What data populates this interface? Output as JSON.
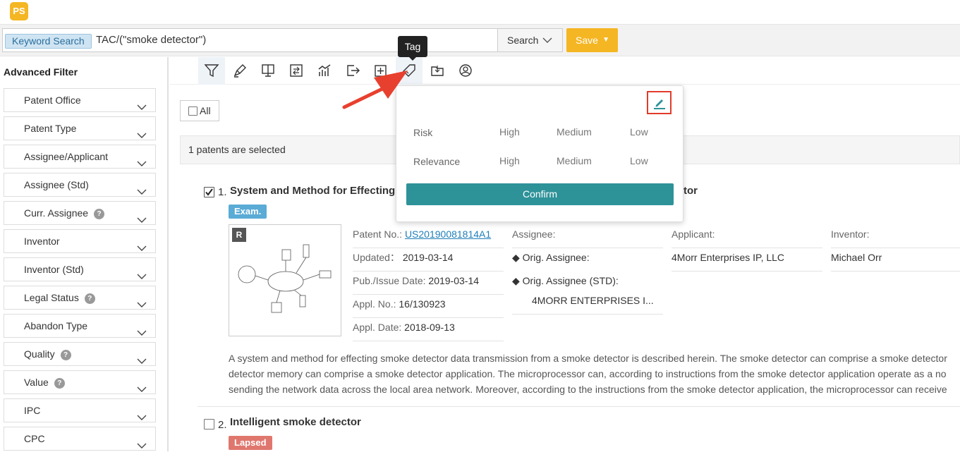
{
  "app": {
    "logo_text": "PS"
  },
  "search": {
    "tag": "Keyword Search",
    "query": "TAC/(\"smoke detector\")",
    "search_label": "Search",
    "save_label": "Save"
  },
  "sidebar": {
    "title": "Advanced Filter",
    "filters": [
      {
        "label": "Patent Office",
        "help": false
      },
      {
        "label": "Patent Type",
        "help": false
      },
      {
        "label": "Assignee/Applicant",
        "help": false
      },
      {
        "label": "Assignee (Std)",
        "help": false
      },
      {
        "label": "Curr. Assignee",
        "help": true
      },
      {
        "label": "Inventor",
        "help": false
      },
      {
        "label": "Inventor (Std)",
        "help": false
      },
      {
        "label": "Legal Status",
        "help": true
      },
      {
        "label": "Abandon Type",
        "help": false
      },
      {
        "label": "Quality",
        "help": true
      },
      {
        "label": "Value",
        "help": true
      },
      {
        "label": "IPC",
        "help": false
      },
      {
        "label": "CPC",
        "help": false
      }
    ]
  },
  "toolbar": {
    "tooltip": "Tag",
    "help_glyph": "?"
  },
  "list": {
    "all_label": "All",
    "selected_text": "1 patents are selected"
  },
  "results": [
    {
      "index": "1.",
      "title_left": "System and Method for Effecting",
      "title_right": "tor",
      "status": "Exam.",
      "status_color": "#5aabd6",
      "thumb_badge": "R",
      "patent_no_label": "Patent No.:",
      "patent_no": "US20190081814A1",
      "updated_label": "Updated：",
      "updated": "2019-03-14",
      "pub_label": "Pub./Issue Date:",
      "pub": "2019-03-14",
      "appl_no_label": "Appl. No.:",
      "appl_no": "16/130923",
      "appl_date_label": "Appl. Date:",
      "appl_date": "2018-09-13",
      "assignee_label": "Assignee:",
      "orig_assignee_label": "◆ Orig. Assignee:",
      "orig_assignee_std_label": "◆ Orig. Assignee (STD):",
      "orig_assignee_std": "4MORR ENTERPRISES I...",
      "applicant_label": "Applicant:",
      "applicant": "4Morr Enterprises IP, LLC",
      "inventor_label": "Inventor:",
      "inventor": "Michael Orr",
      "abstract_lines": [
        "A system and method for effecting smoke detector data transmission from a smoke detector is described herein. The smoke detector can comprise a smoke detector",
        "detector memory can comprise a smoke detector application. The microprocessor can, according to instructions from the smoke detector application operate as a no",
        "sending the network data across the local area network. Moreover, according to the instructions from the smoke detector application, the microprocessor can receive"
      ]
    },
    {
      "index": "2.",
      "title": "Intelligent smoke detector",
      "status": "Lapsed",
      "status_color": "#e0776e"
    }
  ],
  "tag_popup": {
    "rows": [
      {
        "label": "Risk",
        "options": [
          "High",
          "Medium",
          "Low"
        ]
      },
      {
        "label": "Relevance",
        "options": [
          "High",
          "Medium",
          "Low"
        ]
      }
    ],
    "confirm_label": "Confirm"
  },
  "colors": {
    "accent_yellow": "#f5b623",
    "teal": "#2e9299",
    "link": "#1e7fb8",
    "highlight_red": "#e23b2b"
  }
}
